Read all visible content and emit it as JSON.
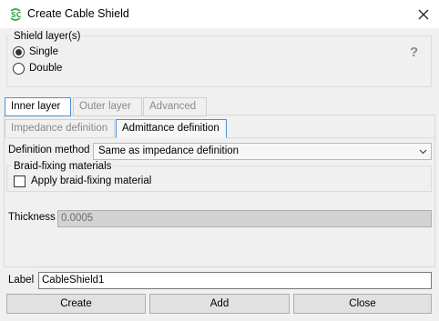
{
  "window": {
    "title": "Create Cable Shield",
    "app_icon": "cable-shield-icon",
    "close_icon": "close-icon"
  },
  "shield_layers": {
    "label": "Shield layer(s)",
    "options": [
      {
        "label": "Single",
        "selected": true
      },
      {
        "label": "Double",
        "selected": false
      }
    ],
    "help": "?"
  },
  "layer_tabs": [
    {
      "label": "Inner layer",
      "active": true
    },
    {
      "label": "Outer layer",
      "active": false
    },
    {
      "label": "Advanced",
      "active": false
    }
  ],
  "definition_tabs": [
    {
      "label": "Impedance definition",
      "active": false
    },
    {
      "label": "Admittance definition",
      "active": true
    }
  ],
  "definition_method": {
    "label": "Definition method",
    "value": "Same as impedance definition"
  },
  "braid_fixing": {
    "label": "Braid-fixing materials",
    "checkbox_label": "Apply braid-fixing material",
    "checked": false
  },
  "thickness": {
    "label": "Thickness",
    "value": "0.0005"
  },
  "label_field": {
    "label": "Label",
    "value": "CableShield1"
  },
  "buttons": {
    "create": "Create",
    "add": "Add",
    "close": "Close"
  },
  "colors": {
    "accent": "#4a90d9",
    "icon_green": "#3aa655"
  }
}
